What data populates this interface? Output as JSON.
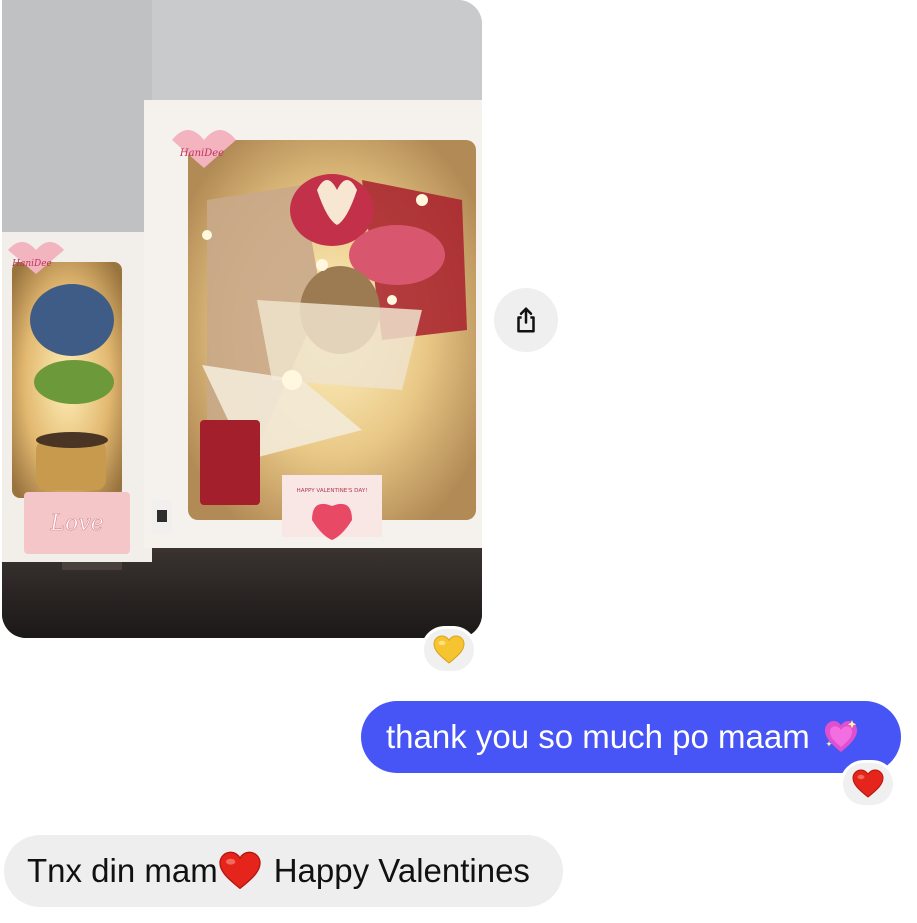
{
  "conversation": {
    "photo_message": {
      "box_logo_text": "HaniDee",
      "card_label": "Love",
      "card_text": "HAPPY VALENTINE'S DAY!",
      "reaction": {
        "icon": "yellow-heart-icon",
        "color": "#f6c431"
      }
    },
    "share_button": {
      "icon": "share-icon"
    },
    "sent_message": {
      "text": "thank you so much po maam",
      "emoji": "sparkling-heart-icon",
      "bubble_color": "#4755f6",
      "reaction": {
        "icon": "red-heart-icon",
        "color": "#e5251b"
      }
    },
    "received_message": {
      "text_before": "Tnx din mam",
      "emoji": "red-heart-icon",
      "text_after": "Happy Valentines",
      "bubble_color": "#eeeeee"
    }
  }
}
